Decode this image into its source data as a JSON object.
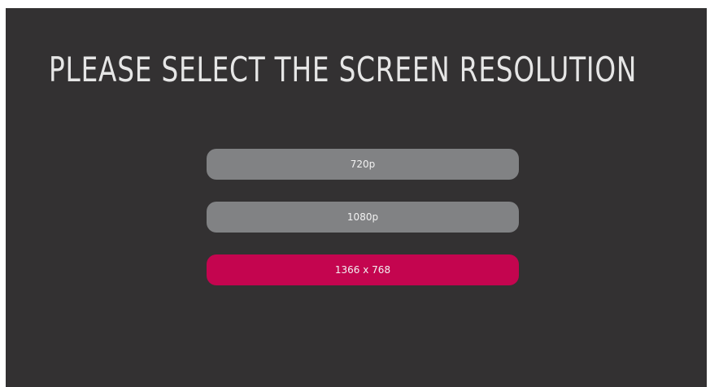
{
  "title": "PLEASE SELECT THE SCREEN RESOLUTION",
  "options": [
    {
      "label": "720p",
      "selected": false
    },
    {
      "label": "1080p",
      "selected": false
    },
    {
      "label": "1366 x 768",
      "selected": true
    }
  ],
  "colors": {
    "background": "#333132",
    "option_default": "#818284",
    "option_selected": "#c4054f",
    "title_text": "#e6e6e6",
    "option_text": "#f2f2f2"
  }
}
